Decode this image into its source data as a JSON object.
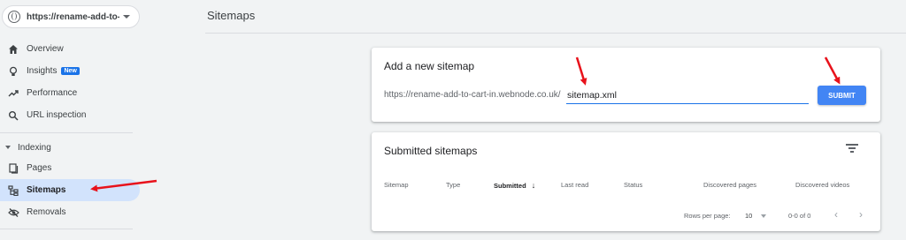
{
  "property": {
    "label": "https://rename-add-to-..."
  },
  "nav": {
    "overview": "Overview",
    "insights": "Insights",
    "insights_badge": "New",
    "performance": "Performance",
    "url_inspection": "URL inspection",
    "indexing_section": "Indexing",
    "pages": "Pages",
    "sitemaps": "Sitemaps",
    "removals": "Removals"
  },
  "header": {
    "title": "Sitemaps"
  },
  "add_sitemap": {
    "title": "Add a new sitemap",
    "url_prefix": "https://rename-add-to-cart-in.webnode.co.uk/",
    "input_value": "sitemap.xml",
    "submit_label": "SUBMIT"
  },
  "submitted": {
    "title": "Submitted sitemaps",
    "columns": [
      "Sitemap",
      "Type",
      "Submitted",
      "Last read",
      "Status",
      "Discovered pages",
      "Discovered videos"
    ],
    "sort_indicator": "↓",
    "rows_per_page_label": "Rows per page:",
    "rows_per_page_value": "10",
    "range": "0-0 of 0",
    "prev": "‹",
    "next": "›"
  },
  "colors": {
    "accent": "#1a73e8",
    "submit_bg": "#4285f4",
    "active_nav_bg": "#d2e3fc",
    "annotation_arrow": "#e8121b"
  },
  "icons": [
    "globe-icon",
    "home-icon",
    "lightbulb-icon",
    "trending-icon",
    "search-icon",
    "pages-icon",
    "sitemap-icon",
    "removals-icon",
    "filter-icon"
  ]
}
